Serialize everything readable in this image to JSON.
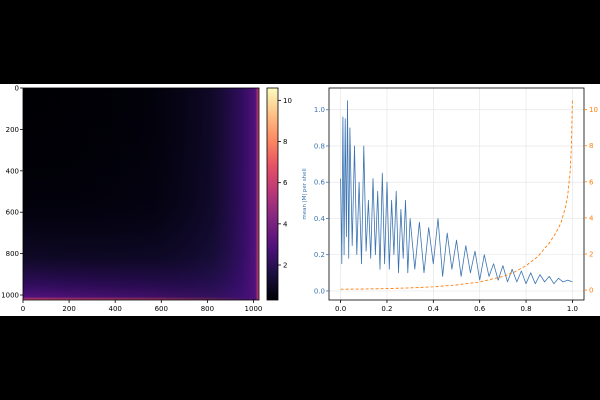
{
  "chart_data": [
    {
      "type": "heatmap",
      "x_ticks": [
        0,
        200,
        400,
        600,
        800,
        1000
      ],
      "y_ticks": [
        0,
        200,
        400,
        600,
        800,
        1000
      ],
      "xlim": [
        0,
        1024
      ],
      "ylim": [
        1024,
        0
      ],
      "colormap": "magma",
      "colorbar": {
        "ticks": [
          2,
          4,
          6,
          8,
          10
        ],
        "range": [
          0.3,
          10.6
        ]
      }
    },
    {
      "type": "line",
      "xlim": [
        -0.05,
        1.05
      ],
      "x_ticks": [
        0.0,
        0.2,
        0.4,
        0.6,
        0.8,
        1.0
      ],
      "x_tick_labels": [
        "0.0",
        "0.2",
        "0.4",
        "0.6",
        "0.8",
        "1.0"
      ],
      "y_left": {
        "label": "mean |M| per shell",
        "ticks": [
          0.0,
          0.2,
          0.4,
          0.6,
          0.8,
          1.0
        ],
        "tick_labels": [
          "0.0",
          "0.2",
          "0.4",
          "0.6",
          "0.8",
          "1.0"
        ],
        "lim": [
          -0.05,
          1.12
        ],
        "color": "#3b73b1"
      },
      "y_right": {
        "ticks": [
          0,
          2,
          4,
          6,
          8,
          10
        ],
        "tick_labels": [
          "0",
          "2",
          "4",
          "6",
          "8",
          "10"
        ],
        "lim": [
          -0.55,
          11.2
        ],
        "color": "#ff7f0e"
      },
      "grid": true,
      "series": [
        {
          "axis": "left",
          "style": "solid",
          "color": "#3b73b1",
          "x": [
            0.0,
            0.005,
            0.01,
            0.015,
            0.02,
            0.025,
            0.03,
            0.035,
            0.04,
            0.05,
            0.06,
            0.07,
            0.08,
            0.09,
            0.1,
            0.11,
            0.12,
            0.13,
            0.14,
            0.15,
            0.16,
            0.17,
            0.18,
            0.19,
            0.2,
            0.21,
            0.22,
            0.23,
            0.24,
            0.25,
            0.26,
            0.27,
            0.28,
            0.29,
            0.3,
            0.32,
            0.34,
            0.36,
            0.38,
            0.4,
            0.42,
            0.44,
            0.46,
            0.48,
            0.5,
            0.52,
            0.54,
            0.56,
            0.58,
            0.6,
            0.62,
            0.64,
            0.66,
            0.68,
            0.7,
            0.72,
            0.74,
            0.76,
            0.78,
            0.8,
            0.82,
            0.84,
            0.86,
            0.88,
            0.9,
            0.92,
            0.94,
            0.96,
            0.98,
            1.0
          ],
          "y": [
            0.62,
            0.15,
            0.96,
            0.2,
            0.95,
            0.3,
            1.05,
            0.18,
            0.9,
            0.25,
            0.8,
            0.2,
            0.6,
            0.15,
            0.8,
            0.22,
            0.5,
            0.18,
            0.62,
            0.2,
            0.55,
            0.12,
            0.65,
            0.15,
            0.6,
            0.12,
            0.5,
            0.2,
            0.55,
            0.1,
            0.45,
            0.18,
            0.5,
            0.1,
            0.4,
            0.12,
            0.38,
            0.1,
            0.35,
            0.15,
            0.4,
            0.08,
            0.32,
            0.12,
            0.28,
            0.08,
            0.25,
            0.1,
            0.22,
            0.06,
            0.2,
            0.08,
            0.15,
            0.06,
            0.14,
            0.05,
            0.12,
            0.05,
            0.11,
            0.04,
            0.1,
            0.04,
            0.09,
            0.05,
            0.08,
            0.04,
            0.07,
            0.05,
            0.06,
            0.05
          ]
        },
        {
          "axis": "right",
          "style": "dashed",
          "color": "#ff7f0e",
          "x": [
            0.0,
            0.1,
            0.2,
            0.3,
            0.4,
            0.5,
            0.6,
            0.7,
            0.75,
            0.8,
            0.85,
            0.9,
            0.93,
            0.95,
            0.97,
            0.98,
            0.99,
            0.995,
            1.0
          ],
          "y": [
            0.05,
            0.06,
            0.08,
            0.12,
            0.18,
            0.28,
            0.45,
            0.75,
            1.0,
            1.35,
            1.85,
            2.6,
            3.2,
            3.7,
            4.6,
            5.3,
            6.5,
            7.8,
            10.5
          ]
        }
      ]
    }
  ]
}
